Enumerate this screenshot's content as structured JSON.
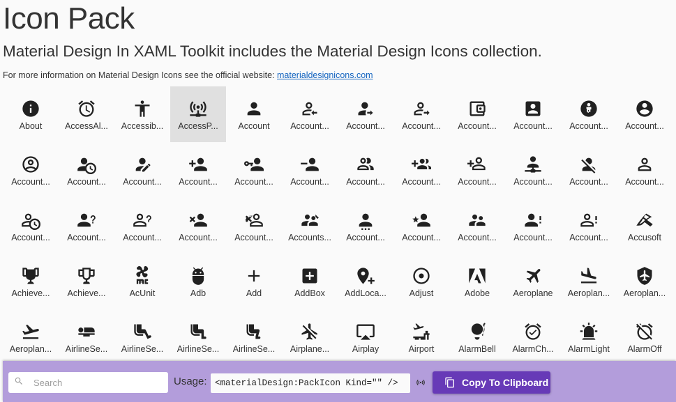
{
  "header": {
    "title": "Icon Pack",
    "subtitle": "Material Design In XAML Toolkit includes the Material Design Icons collection.",
    "info_text": "For more information on Material Design Icons see the official website: ",
    "info_link": "materialdesignicons.com"
  },
  "icons": [
    {
      "label": "About",
      "icon": "information"
    },
    {
      "label": "AccessAl...",
      "icon": "access-alarm"
    },
    {
      "label": "Accessib...",
      "icon": "accessibility"
    },
    {
      "label": "AccessP...",
      "icon": "access-point-network",
      "selected": true
    },
    {
      "label": "Account",
      "icon": "account"
    },
    {
      "label": "Account...",
      "icon": "account-arrow-left-outline"
    },
    {
      "label": "Account...",
      "icon": "account-arrow-right"
    },
    {
      "label": "Account...",
      "icon": "account-arrow-right-outline"
    },
    {
      "label": "Account...",
      "icon": "account-balance-wallet"
    },
    {
      "label": "Account...",
      "icon": "account-box"
    },
    {
      "label": "Account...",
      "icon": "account-child-circle"
    },
    {
      "label": "Account...",
      "icon": "account-circle"
    },
    {
      "label": "Account...",
      "icon": "account-circle-outline"
    },
    {
      "label": "Account...",
      "icon": "account-clock"
    },
    {
      "label": "Account...",
      "icon": "account-edit"
    },
    {
      "label": "Account...",
      "icon": "account-heart"
    },
    {
      "label": "Account...",
      "icon": "account-key"
    },
    {
      "label": "Account...",
      "icon": "account-minus"
    },
    {
      "label": "Account...",
      "icon": "account-multiple-outline"
    },
    {
      "label": "Account...",
      "icon": "account-multiple-plus"
    },
    {
      "label": "Account...",
      "icon": "account-multiple-plus-outline"
    },
    {
      "label": "Account...",
      "icon": "account-network"
    },
    {
      "label": "Account...",
      "icon": "account-off"
    },
    {
      "label": "Account...",
      "icon": "account-outline"
    },
    {
      "label": "Account...",
      "icon": "account-clock-outline"
    },
    {
      "label": "Account...",
      "icon": "account-question"
    },
    {
      "label": "Account...",
      "icon": "account-question-outline"
    },
    {
      "label": "Account...",
      "icon": "account-remove"
    },
    {
      "label": "Account...",
      "icon": "account-remove-outline"
    },
    {
      "label": "Accounts...",
      "icon": "account-multiple-check"
    },
    {
      "label": "Account...",
      "icon": "account-settings"
    },
    {
      "label": "Account...",
      "icon": "account-star"
    },
    {
      "label": "Account...",
      "icon": "account-supervisor"
    },
    {
      "label": "Account...",
      "icon": "account-alert"
    },
    {
      "label": "Account...",
      "icon": "account-alert-outline"
    },
    {
      "label": "Accusoft",
      "icon": "accusoft"
    },
    {
      "label": "Achieve...",
      "icon": "trophy"
    },
    {
      "label": "Achieve...",
      "icon": "trophy-outline"
    },
    {
      "label": "AcUnit",
      "icon": "air-conditioner"
    },
    {
      "label": "Adb",
      "icon": "android-debug-bridge"
    },
    {
      "label": "Add",
      "icon": "plus"
    },
    {
      "label": "AddBox",
      "icon": "plus-box"
    },
    {
      "label": "AddLoca...",
      "icon": "map-marker-plus"
    },
    {
      "label": "Adjust",
      "icon": "adjust"
    },
    {
      "label": "Adobe",
      "icon": "adobe"
    },
    {
      "label": "Aeroplane",
      "icon": "airplane"
    },
    {
      "label": "Aeroplan...",
      "icon": "airplane-landing"
    },
    {
      "label": "Aeroplan...",
      "icon": "shield-airplane"
    },
    {
      "label": "Aeroplan...",
      "icon": "airplane-takeoff"
    },
    {
      "label": "AirlineSe...",
      "icon": "seat-flat"
    },
    {
      "label": "AirlineSe...",
      "icon": "seat-legroom-extra"
    },
    {
      "label": "AirlineSe...",
      "icon": "seat-legroom-normal"
    },
    {
      "label": "AirlineSe...",
      "icon": "seat-legroom-reduced"
    },
    {
      "label": "Airplane...",
      "icon": "airplane-off"
    },
    {
      "label": "Airplay",
      "icon": "airplay"
    },
    {
      "label": "Airport",
      "icon": "airport"
    },
    {
      "label": "AlarmBell",
      "icon": "alarm-bell"
    },
    {
      "label": "AlarmCh...",
      "icon": "alarm-check"
    },
    {
      "label": "AlarmLight",
      "icon": "alarm-light"
    },
    {
      "label": "AlarmOff",
      "icon": "alarm-off"
    }
  ],
  "footer": {
    "search_placeholder": "Search",
    "search_value": "",
    "usage_label": "Usage:",
    "usage_code": "<materialDesign:PackIcon Kind=\"\" />",
    "copy_label": "Copy To Clipboard"
  },
  "colors": {
    "footer_bg": "#b39ddb",
    "button_bg": "#673ab7",
    "selected_bg": "#e0e0e0",
    "link": "#1565c0"
  }
}
